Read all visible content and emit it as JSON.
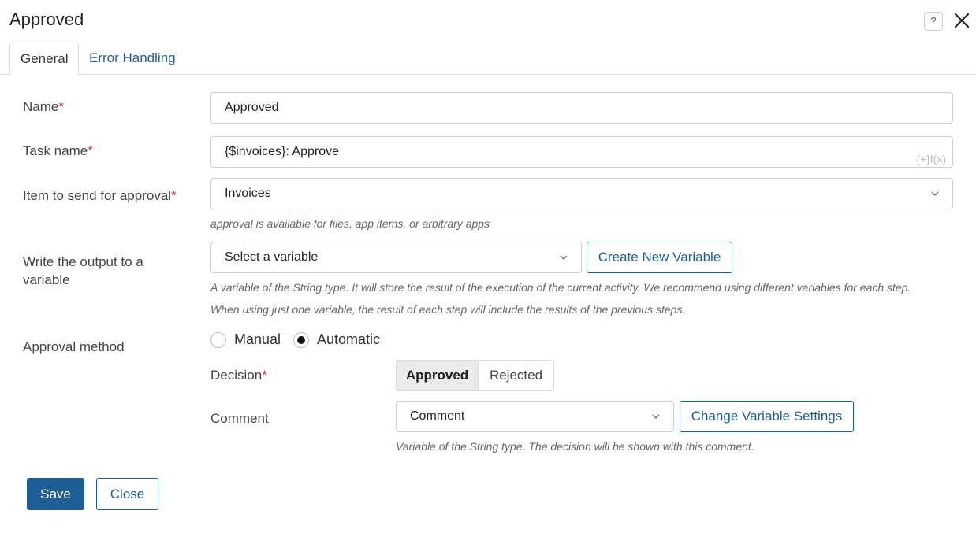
{
  "dialog": {
    "title": "Approved"
  },
  "tabs": [
    {
      "label": "General",
      "active": true
    },
    {
      "label": "Error Handling",
      "active": false
    }
  ],
  "form": {
    "name": {
      "label": "Name",
      "required": "*",
      "value": "Approved"
    },
    "task_name": {
      "label": "Task name",
      "required": "*",
      "value": "{$invoices}: Approve",
      "icon_text": "{+}f(x)"
    },
    "item": {
      "label": "Item to send for approval",
      "required": "*",
      "value": "Invoices",
      "hint": "approval is available for files, app items, or arbitrary apps"
    },
    "output": {
      "label": "Write the output to a variable",
      "placeholder": "Select a variable",
      "button": "Create New Variable",
      "hint_1": "A variable of the String type. It will store the result of the execution of the current activity. We recommend using different variables for each step.",
      "hint_2": "When using just one variable, the result of each step will include the results of the previous steps."
    },
    "method": {
      "label": "Approval method",
      "options": [
        {
          "label": "Manual",
          "checked": false
        },
        {
          "label": "Automatic",
          "checked": true
        }
      ]
    },
    "decision": {
      "label": "Decision",
      "required": "*",
      "options": [
        {
          "label": "Approved",
          "selected": true
        },
        {
          "label": "Rejected",
          "selected": false
        }
      ]
    },
    "comment": {
      "label": "Comment",
      "value": "Comment",
      "button": "Change Variable Settings",
      "hint": "Variable of the String type. The decision will be shown with this comment."
    }
  },
  "footer": {
    "save": "Save",
    "close": "Close"
  },
  "colors": {
    "accent": "#1d5e96",
    "required": "#d0342c"
  }
}
